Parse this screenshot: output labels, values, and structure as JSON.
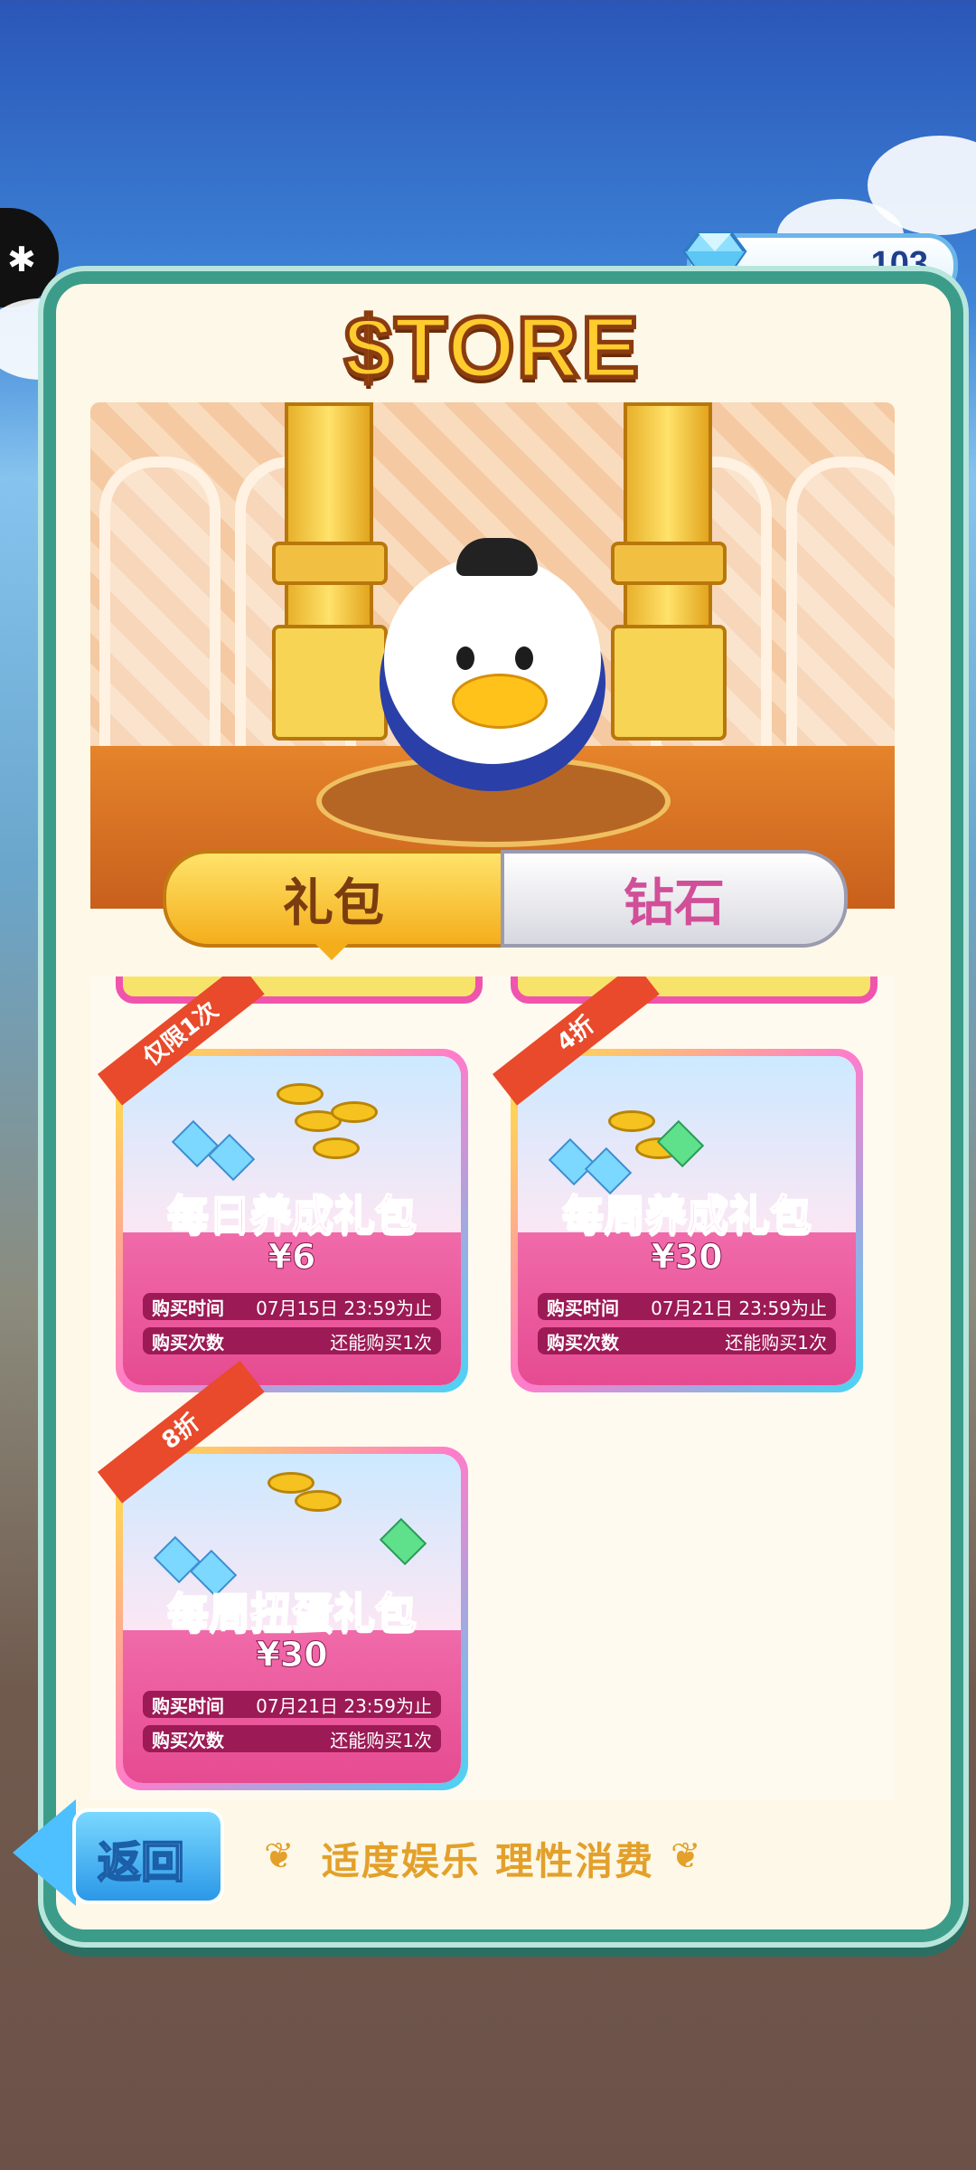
{
  "diamonds": {
    "count": "103"
  },
  "store": {
    "title": "$TORE"
  },
  "tabs": [
    {
      "label": "礼包",
      "selected": true
    },
    {
      "label": "钻石",
      "selected": false
    }
  ],
  "packages": [
    {
      "ribbon": "仅限1次",
      "title": "每日养成礼包",
      "price": "¥6",
      "time_label": "购买时间",
      "time_value": "07月15日  23:59为止",
      "count_label": "购买次数",
      "count_value": "还能购买1次"
    },
    {
      "ribbon": "4折",
      "title": "每周养成礼包",
      "price": "¥30",
      "time_label": "购买时间",
      "time_value": "07月21日  23:59为止",
      "count_label": "购买次数",
      "count_value": "还能购买1次"
    },
    {
      "ribbon": "8折",
      "title": "每周扭蛋礼包",
      "price": "¥30",
      "time_label": "购买时间",
      "time_value": "07月21日  23:59为止",
      "count_label": "购买次数",
      "count_value": "还能购买1次"
    }
  ],
  "footer": {
    "back_label": "返回",
    "slogan": "适度娱乐  理性消费"
  },
  "colors": {
    "frame": "#3c9c8a",
    "accent_pink": "#ff3c9c",
    "tab_gold": "#f4ae1b"
  },
  "icons": {
    "side_tab": "puzzle-icon",
    "currency": "diamond-icon",
    "back": "back-arrow-icon"
  }
}
